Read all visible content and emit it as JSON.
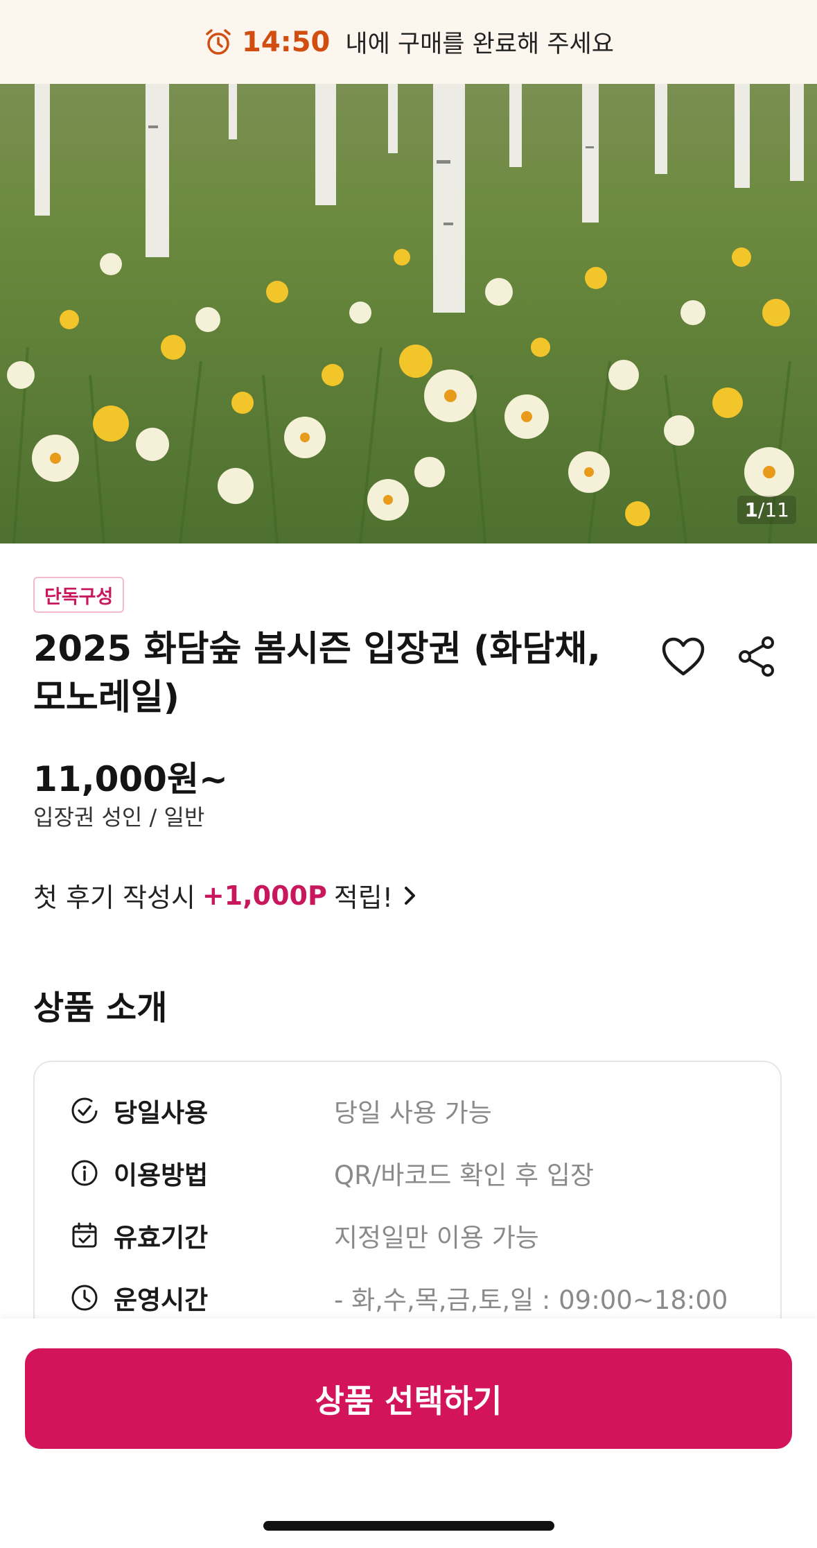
{
  "timer": {
    "time": "14:50",
    "message": "내에 구매를 완료해 주세요",
    "icon": "alarm-clock-icon",
    "accent_color": "#d14e10"
  },
  "gallery": {
    "current": "1",
    "separator": "/",
    "total": "11"
  },
  "product": {
    "badge": "단독구성",
    "title_line1": "2025 화담숲 봄시즌 입장권 (화담채,",
    "title_line2": "모노레일)",
    "price": "11,000원~",
    "price_sub": "입장권 성인 / 일반",
    "accent_color": "#c8175d"
  },
  "review": {
    "prefix": "첫 후기 작성시",
    "points": "+1,000P",
    "suffix": "적립!"
  },
  "intro": {
    "title": "상품 소개",
    "rows": [
      {
        "icon": "check-circle-icon",
        "label": "당일사용",
        "value": "당일 사용 가능"
      },
      {
        "icon": "info-circle-icon",
        "label": "이용방법",
        "value": "QR/바코드 확인 후 입장"
      },
      {
        "icon": "calendar-check-icon",
        "label": "유효기간",
        "value": "지정일만 이용 가능"
      },
      {
        "icon": "clock-icon",
        "label": "운영시간",
        "value": "- 화,수,목,금,토,일 : 09:00~18:00"
      }
    ]
  },
  "cta": {
    "label": "상품 선택하기",
    "color": "#d4145a"
  }
}
